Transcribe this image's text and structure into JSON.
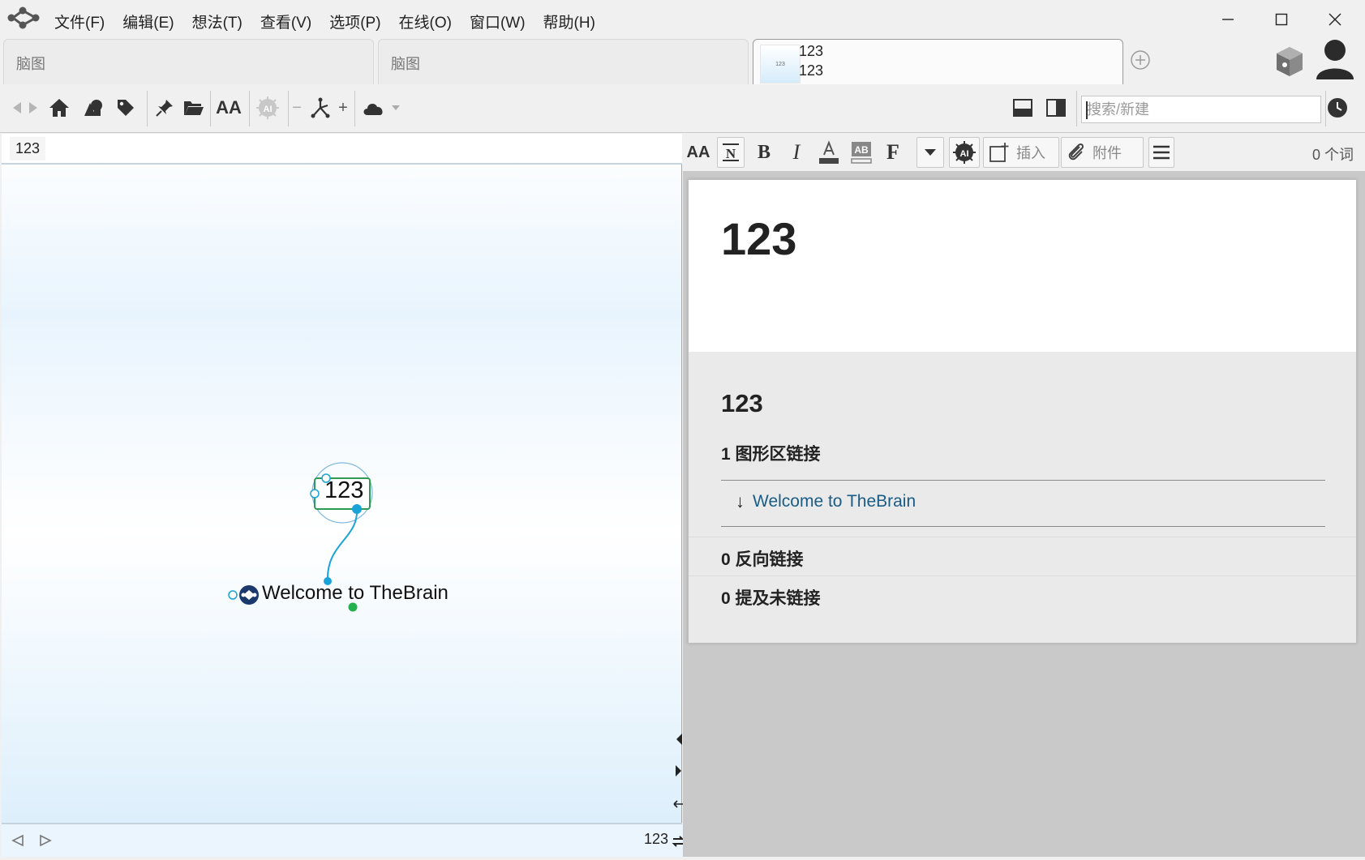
{
  "menu": [
    "文件(F)",
    "编辑(E)",
    "想法(T)",
    "查看(V)",
    "选项(P)",
    "在线(O)",
    "窗口(W)",
    "帮助(H)"
  ],
  "window_controls": {
    "minimize": "—",
    "maximize": "☐",
    "close": "✕"
  },
  "tabs": [
    {
      "label": "脑图"
    },
    {
      "label": "脑图"
    },
    {
      "thumb_text": "123",
      "line1": "123",
      "line2": "123",
      "active": true
    }
  ],
  "toolbar": {
    "icons": [
      "back-icon",
      "forward-icon",
      "home-icon",
      "shapes-icon",
      "tag-icon",
      "pin-icon",
      "folder-icon",
      "font-size-icon",
      "ai-icon",
      "collapse-icon",
      "network-icon",
      "expand-icon",
      "cloud-icon"
    ],
    "minus": "−",
    "plus": "+",
    "font_size": "AA",
    "search_placeholder": "搜索/新建"
  },
  "map": {
    "breadcrumb": "123",
    "active_node": "123",
    "child_node": "Welcome to TheBrain",
    "footer_label": "123"
  },
  "notes_toolbar": {
    "font_size": "AA",
    "bold": "B",
    "italic": "I",
    "format": "F",
    "insert": "插入",
    "attachment": "附件",
    "word_count": "0 个词"
  },
  "notes": {
    "title": "123",
    "subtitle": "123",
    "graph_links": "1 图形区链接",
    "link_arrow": "↓",
    "link_text": "Welcome to TheBrain",
    "back_links": "0 反向链接",
    "unlinked_mentions": "0 提及未链接"
  },
  "colors": {
    "accent": "#1aa3d9",
    "link": "#1a5c86",
    "node_border": "#2e9a55",
    "green_dot": "#22b14c"
  }
}
